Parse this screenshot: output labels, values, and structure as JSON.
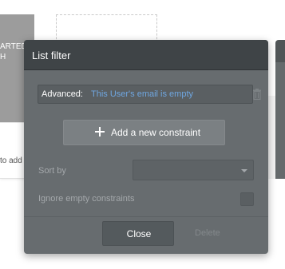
{
  "background": {
    "left_block_text": "ARTED\nH",
    "left_panel_text": "to add"
  },
  "modal": {
    "title": "List filter",
    "advanced": {
      "label": "Advanced:",
      "value": "This User's email is empty",
      "delete_icon": "trash-icon"
    },
    "add_constraint": {
      "icon": "plus-icon",
      "label": "Add a new constraint"
    },
    "sort_by": {
      "label": "Sort by",
      "value": ""
    },
    "ignore_empty": {
      "label": "Ignore empty constraints",
      "checked": false
    },
    "footer": {
      "close_label": "Close",
      "delete_label": "Delete"
    }
  },
  "colors": {
    "modal_bg": "#676c6f",
    "header_bg": "#3f4447",
    "link_blue": "#6fa6e0"
  }
}
